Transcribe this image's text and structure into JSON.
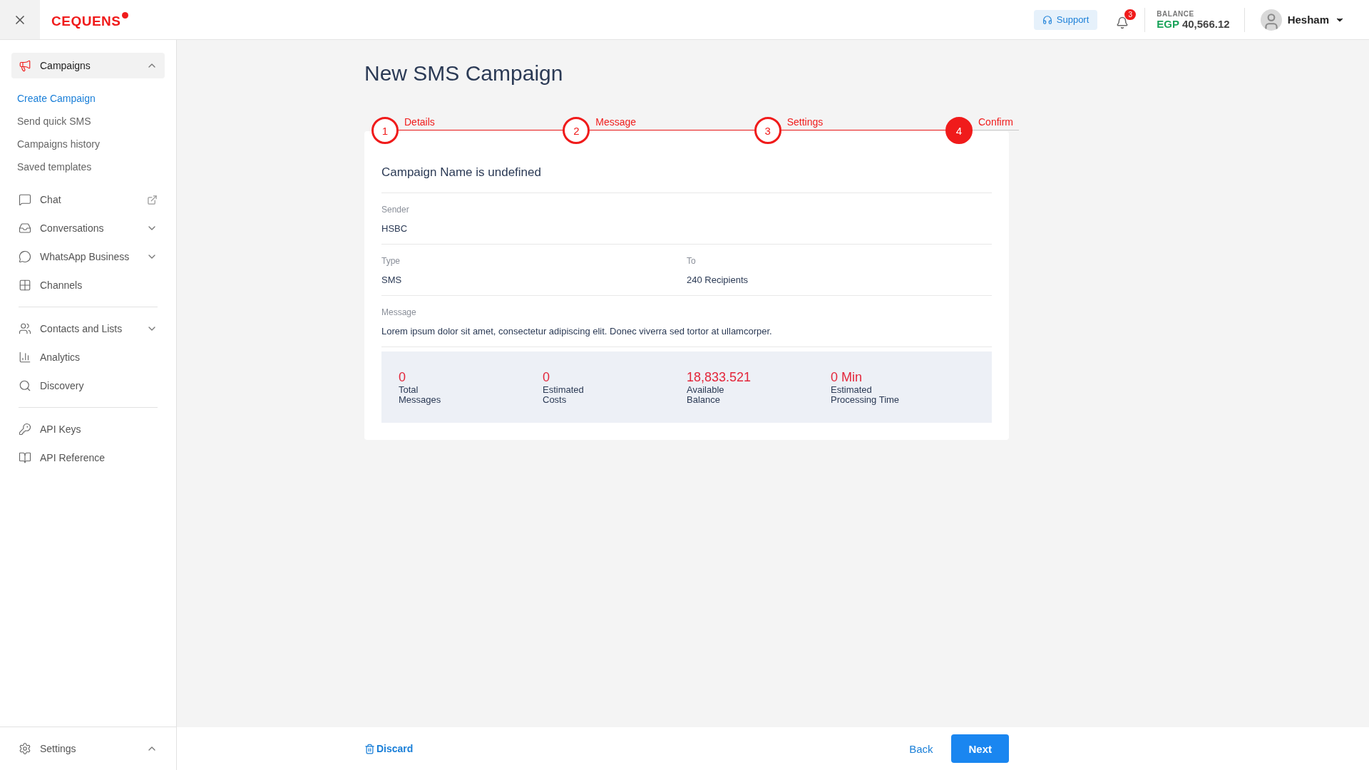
{
  "header": {
    "logo": "CEQUENS",
    "support": "Support",
    "notifications": "3",
    "balance_label": "BALANCE",
    "currency": "EGP",
    "balance": "40,566.12",
    "user": "Hesham"
  },
  "sidebar": {
    "groups": [
      [
        {
          "label": "Campaigns",
          "kind": "menu",
          "selected": true,
          "expanded": true,
          "children": [
            {
              "label": "Create Campaign",
              "selected": true
            },
            {
              "label": "Send quick SMS",
              "selected": false
            },
            {
              "label": "Campaigns history",
              "selected": false
            },
            {
              "label": "Saved templates",
              "selected": false
            }
          ]
        },
        {
          "label": "Chat",
          "kind": "external",
          "selected": false
        },
        {
          "label": "Conversations",
          "kind": "menu",
          "selected": false,
          "expanded": false
        },
        {
          "label": "WhatsApp Business",
          "kind": "menu",
          "selected": false,
          "expanded": false
        },
        {
          "label": "Channels",
          "kind": "plain",
          "selected": false
        }
      ],
      [
        {
          "label": "Contacts and Lists",
          "kind": "menu",
          "selected": false,
          "expanded": false
        },
        {
          "label": "Analytics",
          "kind": "plain",
          "selected": false
        },
        {
          "label": "Discovery",
          "kind": "plain",
          "selected": false
        }
      ],
      [
        {
          "label": "API Keys",
          "kind": "plain",
          "selected": false
        },
        {
          "label": "API Reference",
          "kind": "plain",
          "selected": false
        }
      ]
    ],
    "settings": {
      "label": "Settings",
      "expanded": true
    }
  },
  "page": {
    "title": "New SMS Campaign",
    "steps": [
      {
        "number": "1",
        "label": "Details",
        "selected": false
      },
      {
        "number": "2",
        "label": "Message",
        "selected": false
      },
      {
        "number": "3",
        "label": "Settings",
        "selected": false
      },
      {
        "number": "4",
        "label": "Confirm",
        "selected": true
      }
    ],
    "summary": {
      "heading": "Campaign Name is undefined",
      "rows": [
        [
          {
            "label": "Sender",
            "value": "HSBC"
          }
        ],
        [
          {
            "label": "Type",
            "value": "SMS"
          },
          {
            "label": "To",
            "value": "240 Recipients"
          }
        ],
        [
          {
            "label": "Message",
            "value": "Lorem ipsum dolor sit amet, consectetur adipiscing elit. Donec viverra sed tortor at ullamcorper."
          }
        ]
      ],
      "stats": [
        {
          "value": "0",
          "label": "Total\nMessages"
        },
        {
          "value": "0",
          "label": "Estimated\nCosts"
        },
        {
          "value": "18,833.521",
          "label": "Available\nBalance"
        },
        {
          "value": "0 Min",
          "label": "Estimated\nProcessing Time"
        }
      ]
    }
  },
  "footer": {
    "discard": "Discard",
    "back": "Back",
    "next": "Next"
  }
}
